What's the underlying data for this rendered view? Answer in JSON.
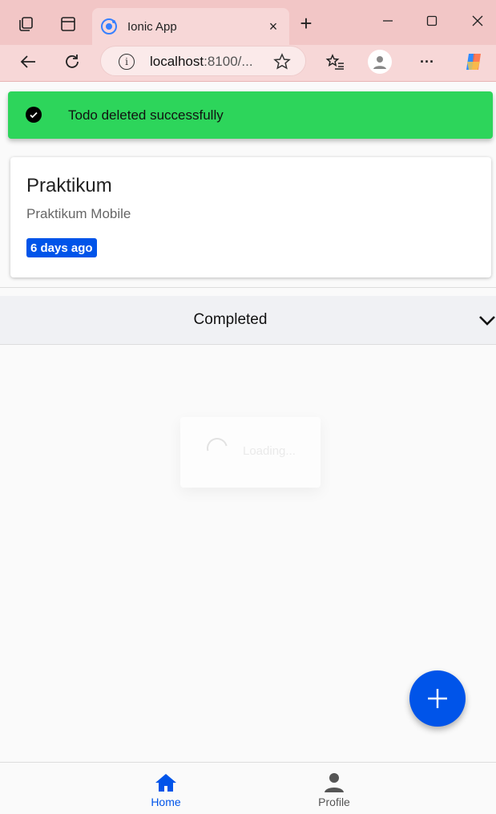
{
  "browser": {
    "tab_title": "Ionic App",
    "tab_close": "×",
    "new_tab": "+",
    "url_host": "localhost",
    "url_rest": ":8100/...",
    "info_glyph": "i",
    "menu_glyph": "···",
    "icons": [
      "tab-actions-icon",
      "vertical-tabs-icon",
      "back-icon",
      "refresh-icon",
      "favorites-star-icon",
      "favorites-list-icon",
      "profile-icon",
      "more-icon",
      "copilot-icon",
      "minimize-icon",
      "maximize-icon",
      "close-window-icon"
    ]
  },
  "toast": {
    "message": "Todo deleted successfully",
    "color": "#2dd55b"
  },
  "todo_card": {
    "title": "Praktikum",
    "subtitle": "Praktikum Mobile",
    "badge": "6 days ago",
    "badge_color": "#0054e9"
  },
  "accordion": {
    "label": "Completed"
  },
  "loading": {
    "text": "Loading..."
  },
  "tabs": {
    "home_label": "Home",
    "profile_label": "Profile",
    "active_color": "#0054e9",
    "inactive_color": "#555555"
  }
}
